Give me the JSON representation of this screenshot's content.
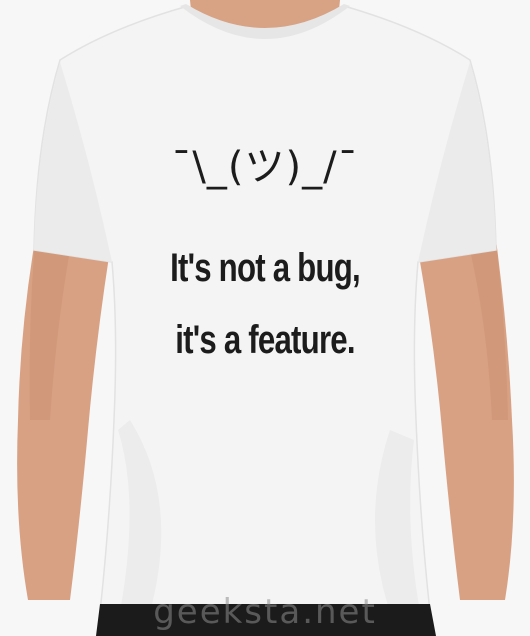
{
  "shirt": {
    "emoticon": "¯\\_(ツ)_/¯",
    "slogan_line1": "It's not a bug,",
    "slogan_line2": "it's a feature."
  },
  "watermark": {
    "text": "geeksta.net"
  },
  "colors": {
    "shirt": "#f3f3f3",
    "skin": "#d9a183",
    "print": "#1c1c1c",
    "pants": "#1a1a1a"
  }
}
